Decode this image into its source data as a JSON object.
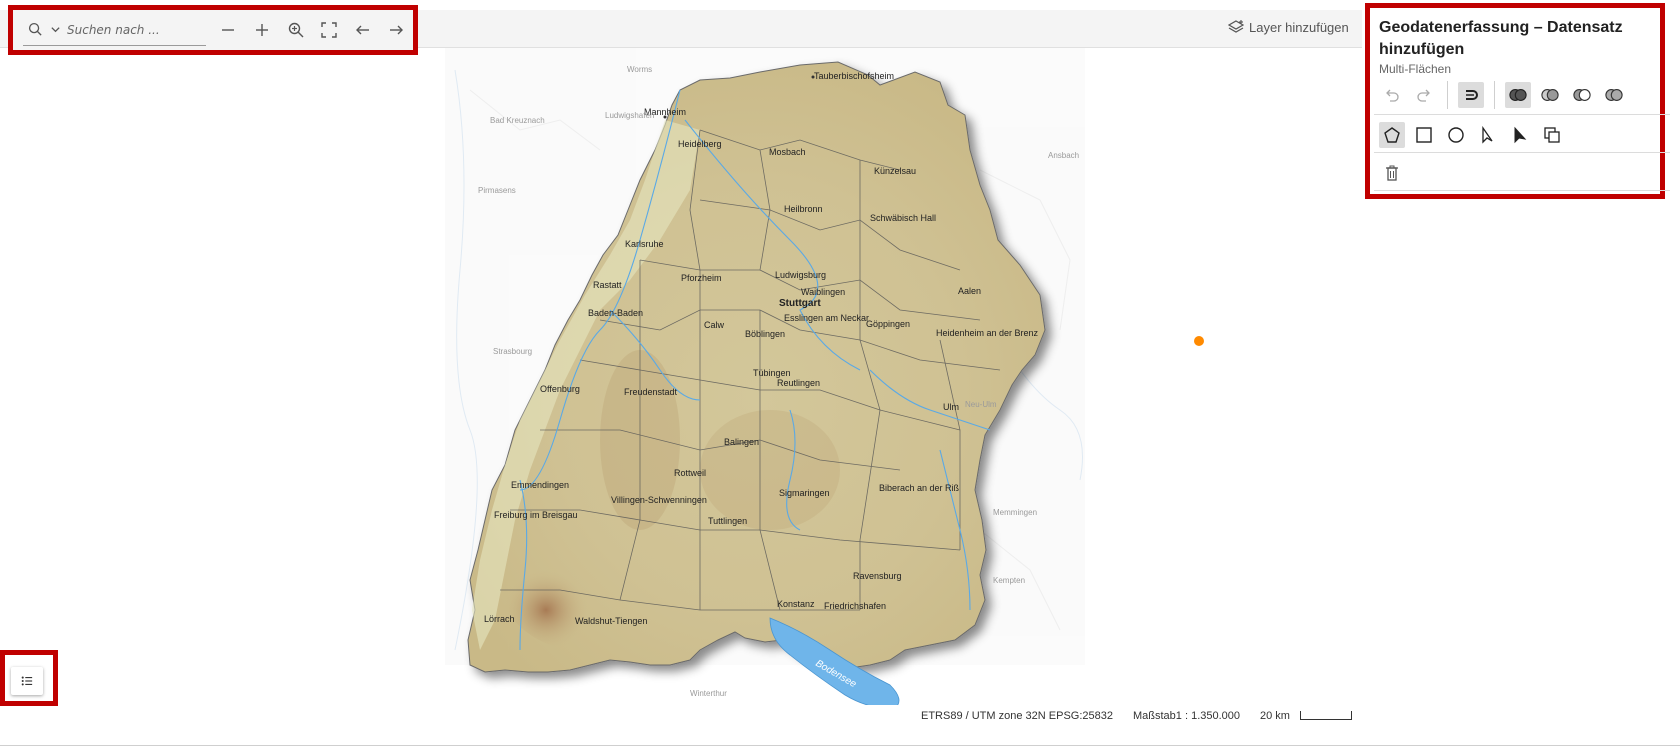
{
  "toolbar": {
    "search_placeholder": "Suchen nach ...",
    "buttons": [
      "zoom-out",
      "zoom-in",
      "zoom-to-extent",
      "fullscreen",
      "back",
      "forward"
    ],
    "layer_add_label": "Layer hinzufügen"
  },
  "panel": {
    "title": "Geodatenerfassung – Datensatz hinzufügen",
    "subtitle": "Multi-Flächen",
    "row1_icons": [
      "undo-icon",
      "redo-icon",
      "snapping-icon",
      "union-icon",
      "intersect-icon",
      "difference-icon",
      "symmetric-difference-icon"
    ],
    "row2_icons": [
      "polygon-icon",
      "rectangle-icon",
      "circle-icon",
      "select-icon",
      "modify-icon",
      "duplicate-icon"
    ],
    "row3_icons": [
      "trash-icon"
    ]
  },
  "map": {
    "cities": [
      "Tauberbischofsheim",
      "Mannheim",
      "Heidelberg",
      "Mosbach",
      "Künzelsau",
      "Heilbronn",
      "Schwäbisch Hall",
      "Karlsruhe",
      "Rastatt",
      "Pforzheim",
      "Ludwigsburg",
      "Waiblingen",
      "Stuttgart",
      "Aalen",
      "Baden-Baden",
      "Calw",
      "Böblingen",
      "Esslingen am Neckar",
      "Göppingen",
      "Heidenheim an der Brenz",
      "Offenburg",
      "Freudenstadt",
      "Tübingen",
      "Reutlingen",
      "Ulm",
      "Balingen",
      "Rottweil",
      "Emmendingen",
      "Villingen-Schwenningen",
      "Sigmaringen",
      "Biberach an der Riß",
      "Freiburg im Breisgau",
      "Tuttlingen",
      "Ravensburg",
      "Konstanz",
      "Friedrichshafen",
      "Lörrach",
      "Waldshut-Tiengen"
    ],
    "lake_label": "Bodensee",
    "outside_labels": [
      "Worms",
      "Ludwigshafen",
      "Bad Kreuznach",
      "Pirmasens",
      "Strasbourg",
      "Neu-Ulm",
      "Kempten",
      "Memmingen",
      "Ansbach",
      "Winterthur"
    ]
  },
  "legend": {
    "icon": "list-icon"
  },
  "status": {
    "projection": "ETRS89 / UTM zone 32N EPSG:25832",
    "scale": "Maßstab1 : 1.350.000",
    "scalebar_label": "20 km"
  },
  "colors": {
    "highlight_border": "#c00000",
    "marker": "#ff8a00",
    "land": "#d9cfa3",
    "water": "#5aa9e6"
  }
}
